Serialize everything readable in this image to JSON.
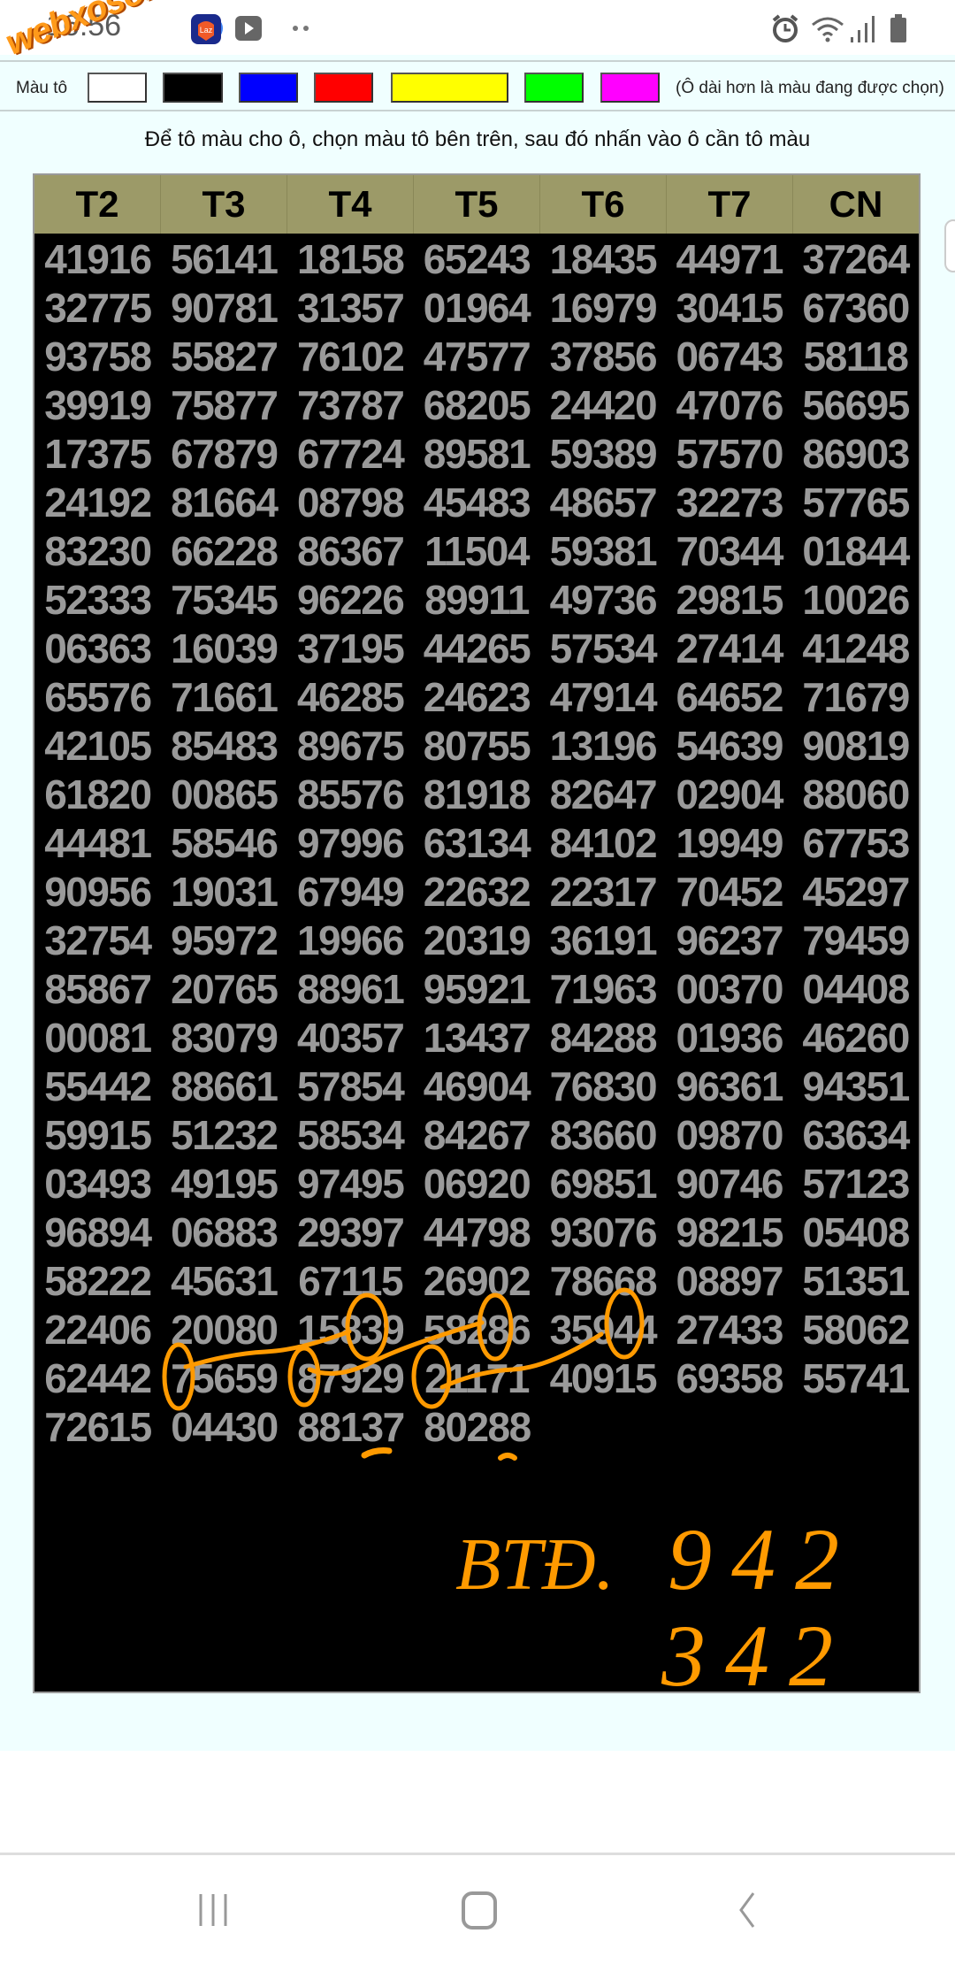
{
  "status_bar": {
    "time": "16:56",
    "watermark": "webxoso.net",
    "app_icons": [
      "chrome-icon",
      "lazada-icon",
      "youtube-icon",
      "more-dots-icon"
    ],
    "system_icons": [
      "alarm-icon",
      "wifi-icon",
      "signal-icon",
      "battery-icon"
    ]
  },
  "palette": {
    "label": "Màu tô",
    "swatches": [
      {
        "name": "white",
        "color": "#ffffff"
      },
      {
        "name": "black",
        "color": "#000000"
      },
      {
        "name": "blue",
        "color": "#0000ff"
      },
      {
        "name": "red",
        "color": "#ff0000"
      },
      {
        "name": "yellow",
        "color": "#ffff00",
        "selected": true
      },
      {
        "name": "green",
        "color": "#00ff00"
      },
      {
        "name": "magenta",
        "color": "#ff00ff"
      }
    ],
    "note": "(Ô dài hơn là màu đang được chọn)"
  },
  "instruction": "Để tô màu cho ô, chọn màu tô bên trên, sau đó nhấn vào ô cần tô màu",
  "table": {
    "header_color": "#9c9a68",
    "headers": [
      "T2",
      "T3",
      "T4",
      "T5",
      "T6",
      "T7",
      "CN"
    ],
    "rows": [
      [
        "41916",
        "56141",
        "18158",
        "65243",
        "18435",
        "44971",
        "37264"
      ],
      [
        "32775",
        "90781",
        "31357",
        "01964",
        "16979",
        "30415",
        "67360"
      ],
      [
        "93758",
        "55827",
        "76102",
        "47577",
        "37856",
        "06743",
        "58118"
      ],
      [
        "39919",
        "75877",
        "73787",
        "68205",
        "24420",
        "47076",
        "56695"
      ],
      [
        "17375",
        "67879",
        "67724",
        "89581",
        "59389",
        "57570",
        "86903"
      ],
      [
        "24192",
        "81664",
        "08798",
        "45483",
        "48657",
        "32273",
        "57765"
      ],
      [
        "83230",
        "66228",
        "86367",
        "11504",
        "59381",
        "70344",
        "01844"
      ],
      [
        "52333",
        "75345",
        "96226",
        "89911",
        "49736",
        "29815",
        "10026"
      ],
      [
        "06363",
        "16039",
        "37195",
        "44265",
        "57534",
        "27414",
        "41248"
      ],
      [
        "65576",
        "71661",
        "46285",
        "24623",
        "47914",
        "64652",
        "71679"
      ],
      [
        "42105",
        "85483",
        "89675",
        "80755",
        "13196",
        "54639",
        "90819"
      ],
      [
        "61820",
        "00865",
        "85576",
        "81918",
        "82647",
        "02904",
        "88060"
      ],
      [
        "44481",
        "58546",
        "97996",
        "63134",
        "84102",
        "19949",
        "67753"
      ],
      [
        "90956",
        "19031",
        "67949",
        "22632",
        "22317",
        "70452",
        "45297"
      ],
      [
        "32754",
        "95972",
        "19966",
        "20319",
        "36191",
        "96237",
        "79459"
      ],
      [
        "85867",
        "20765",
        "88961",
        "95921",
        "71963",
        "00370",
        "04408"
      ],
      [
        "00081",
        "83079",
        "40357",
        "13437",
        "84288",
        "01936",
        "46260"
      ],
      [
        "55442",
        "88661",
        "57854",
        "46904",
        "76830",
        "96361",
        "94351"
      ],
      [
        "59915",
        "51232",
        "58534",
        "84267",
        "83660",
        "09870",
        "63634"
      ],
      [
        "03493",
        "49195",
        "97495",
        "06920",
        "69851",
        "90746",
        "57123"
      ],
      [
        "96894",
        "06883",
        "29397",
        "44798",
        "93076",
        "98215",
        "05408"
      ],
      [
        "58222",
        "45631",
        "67115",
        "26902",
        "78668",
        "08897",
        "51351"
      ],
      [
        "22406",
        "20080",
        "15839",
        "58286",
        "35944",
        "27433",
        "58062"
      ],
      [
        "62442",
        "75659",
        "87929",
        "21171",
        "40915",
        "69358",
        "55741"
      ],
      [
        "72615",
        "04430",
        "88137",
        "80288"
      ]
    ]
  },
  "annotation": {
    "color": "#ff9a00",
    "label": "BTĐ.",
    "line1": "942",
    "line2": "342"
  },
  "navbar": {
    "icons": [
      "recent-apps-icon",
      "home-icon",
      "back-icon"
    ]
  }
}
